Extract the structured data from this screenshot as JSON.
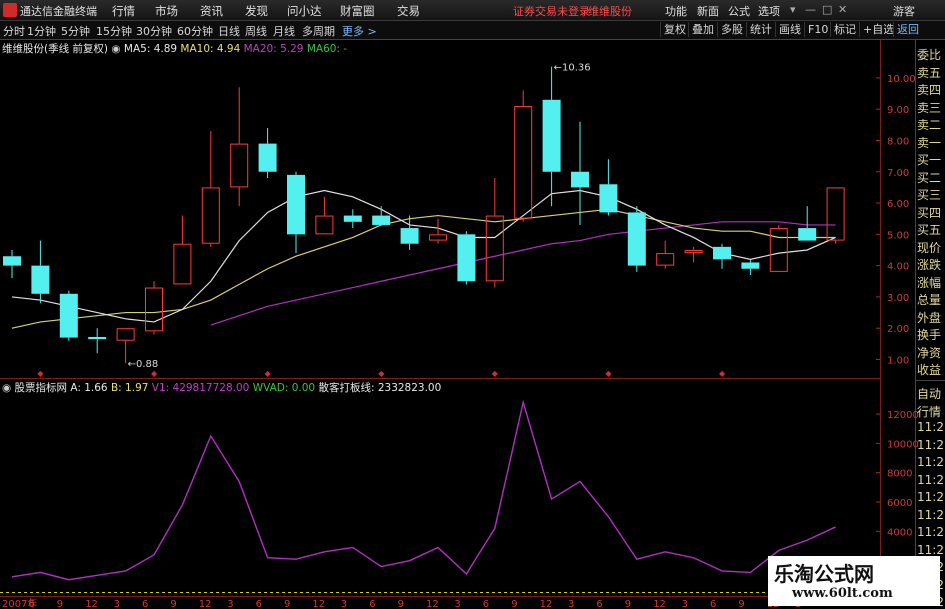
{
  "app": {
    "title": "通达信金融终端"
  },
  "menu": [
    "行情",
    "市场",
    "资讯",
    "发现",
    "问小达",
    "财富圈",
    "交易"
  ],
  "alerts": {
    "trade_login": "证券交易未登录",
    "stock": "维维股份"
  },
  "right_menu": [
    "功能",
    "新面",
    "公式",
    "选项"
  ],
  "guest_label": "游客",
  "toolbar": {
    "periods": [
      "分时",
      "1分钟",
      "5分钟",
      "15分钟",
      "30分钟",
      "60分钟",
      "日线",
      "周线",
      "月线",
      "多周期"
    ],
    "more": "更多",
    "right": [
      "复权",
      "叠加",
      "多股",
      "统计",
      "画线",
      "F10",
      "标记",
      "+自选",
      "返回"
    ]
  },
  "main_chart": {
    "stock_info": "维维股份(季线 前复权)",
    "ma": [
      {
        "label": "MA5: 4.89",
        "color": "#e8e8e8"
      },
      {
        "label": "MA10: 4.94",
        "color": "#e8e070"
      },
      {
        "label": "MA20: 5.29",
        "color": "#c040c0"
      },
      {
        "label": "MA60: -",
        "color": "#40c040"
      }
    ],
    "high_label": "10.36",
    "low_label": "0.88"
  },
  "sub_chart": {
    "indicator": "股票指标网",
    "values": [
      {
        "label": "A: 1.66",
        "color": "#e8e8e8"
      },
      {
        "label": "B: 1.97",
        "color": "#e8e070"
      },
      {
        "label": "V1: 429817728.00",
        "color": "#c040c0"
      },
      {
        "label": "WVAD: 0.00",
        "color": "#40c040"
      },
      {
        "label": "散客打板线: 2332823.00",
        "color": "#e8e8e8"
      }
    ]
  },
  "right_panel_top": [
    "委比",
    "卖五",
    "卖四",
    "卖三",
    "卖二",
    "卖一",
    "买一",
    "买二",
    "买三",
    "买四",
    "买五",
    "现价",
    "涨跌",
    "涨幅",
    "总量",
    "外盘",
    "换手",
    "净资",
    "收益"
  ],
  "right_panel_bottom": [
    "自动",
    "行情",
    "11:2",
    "11:2",
    "11:2",
    "11:2",
    "11:2",
    "11:2",
    "11:2",
    "11:2",
    "11:2",
    "11:2",
    "11:2"
  ],
  "chart_data": [
    {
      "type": "candlestick",
      "title": "维维股份(季线 前复权)",
      "ylim": [
        0.6,
        10.7
      ],
      "yticks": [
        "10.00",
        "9.00",
        "8.00",
        "7.00",
        "6.00",
        "5.00",
        "4.00",
        "3.00",
        "2.00",
        "1.00"
      ],
      "ytick_values": [
        10,
        9,
        8,
        7,
        6,
        5,
        4,
        3,
        2,
        1
      ],
      "candles": [
        {
          "o": 4.3,
          "h": 4.5,
          "l": 3.6,
          "c": 4.0
        },
        {
          "o": 4.0,
          "h": 4.8,
          "l": 2.8,
          "c": 3.1
        },
        {
          "o": 3.1,
          "h": 3.2,
          "l": 1.6,
          "c": 1.7
        },
        {
          "o": 1.72,
          "h": 2.0,
          "l": 1.2,
          "c": 1.65
        },
        {
          "o": 1.6,
          "h": 2.0,
          "l": 0.88,
          "c": 2.0
        },
        {
          "o": 1.9,
          "h": 3.5,
          "l": 1.8,
          "c": 3.3
        },
        {
          "o": 3.4,
          "h": 5.6,
          "l": 3.4,
          "c": 4.7
        },
        {
          "o": 4.7,
          "h": 8.3,
          "l": 4.6,
          "c": 6.5
        },
        {
          "o": 6.5,
          "h": 9.7,
          "l": 5.9,
          "c": 7.9
        },
        {
          "o": 7.9,
          "h": 8.4,
          "l": 6.8,
          "c": 7.0
        },
        {
          "o": 6.9,
          "h": 7.0,
          "l": 4.4,
          "c": 5.0
        },
        {
          "o": 5.0,
          "h": 6.2,
          "l": 5.0,
          "c": 5.6
        },
        {
          "o": 5.6,
          "h": 5.8,
          "l": 5.2,
          "c": 5.4
        },
        {
          "o": 5.6,
          "h": 5.9,
          "l": 5.3,
          "c": 5.3
        },
        {
          "o": 5.2,
          "h": 5.6,
          "l": 4.5,
          "c": 4.7
        },
        {
          "o": 4.8,
          "h": 5.5,
          "l": 4.7,
          "c": 5.0
        },
        {
          "o": 5.0,
          "h": 5.1,
          "l": 3.4,
          "c": 3.5
        },
        {
          "o": 3.5,
          "h": 6.8,
          "l": 3.3,
          "c": 5.6
        },
        {
          "o": 5.5,
          "h": 9.6,
          "l": 5.4,
          "c": 9.1
        },
        {
          "o": 9.3,
          "h": 10.36,
          "l": 5.9,
          "c": 7.0
        },
        {
          "o": 7.0,
          "h": 8.6,
          "l": 5.3,
          "c": 6.5
        },
        {
          "o": 6.6,
          "h": 7.4,
          "l": 5.6,
          "c": 5.7
        },
        {
          "o": 5.7,
          "h": 5.9,
          "l": 3.8,
          "c": 4.0
        },
        {
          "o": 4.0,
          "h": 4.8,
          "l": 3.9,
          "c": 4.4
        },
        {
          "o": 4.4,
          "h": 4.6,
          "l": 4.1,
          "c": 4.5
        },
        {
          "o": 4.6,
          "h": 4.7,
          "l": 3.9,
          "c": 4.2
        },
        {
          "o": 4.1,
          "h": 4.2,
          "l": 3.7,
          "c": 3.9
        },
        {
          "o": 3.8,
          "h": 5.3,
          "l": 3.8,
          "c": 5.2
        },
        {
          "o": 5.2,
          "h": 5.9,
          "l": 4.8,
          "c": 4.8
        },
        {
          "o": 4.8,
          "h": 6.5,
          "l": 4.7,
          "c": 6.5
        }
      ],
      "ma5": [
        3.0,
        2.9,
        2.7,
        2.5,
        2.3,
        2.2,
        2.6,
        3.5,
        4.8,
        5.7,
        6.2,
        6.4,
        6.2,
        5.8,
        5.3,
        5.2,
        4.9,
        4.9,
        5.6,
        6.3,
        6.4,
        6.2,
        5.8,
        5.3,
        4.9,
        4.4,
        4.2,
        4.4,
        4.5,
        4.9
      ],
      "ma10": [
        2.0,
        2.2,
        2.3,
        2.4,
        2.5,
        2.5,
        2.6,
        2.9,
        3.4,
        3.9,
        4.3,
        4.6,
        4.9,
        5.3,
        5.5,
        5.6,
        5.5,
        5.4,
        5.5,
        5.6,
        5.7,
        5.8,
        5.6,
        5.4,
        5.2,
        5.1,
        5.1,
        4.9,
        4.9,
        4.9
      ],
      "ma20": [
        null,
        null,
        null,
        null,
        null,
        null,
        null,
        2.1,
        2.4,
        2.7,
        2.9,
        3.1,
        3.3,
        3.5,
        3.7,
        3.9,
        4.1,
        4.3,
        4.5,
        4.7,
        4.8,
        5.0,
        5.1,
        5.2,
        5.3,
        5.4,
        5.4,
        5.4,
        5.3,
        5.3
      ]
    },
    {
      "type": "line",
      "title": "股票指标网",
      "ylim": [
        0,
        13500
      ],
      "yticks": [
        "12000",
        "10000",
        "8000",
        "6000",
        "4000",
        "2000"
      ],
      "ytick_values": [
        12000,
        10000,
        8000,
        6000,
        4000,
        2000
      ],
      "series": [
        {
          "name": "V1",
          "values": [
            900,
            1200,
            700,
            1000,
            1300,
            2400,
            5800,
            10500,
            7400,
            2200,
            2100,
            2600,
            2900,
            1600,
            2000,
            2900,
            1100,
            4200,
            12800,
            6200,
            7400,
            5000,
            2100,
            2600,
            2200,
            1300,
            1200,
            2700,
            3400,
            4300
          ]
        }
      ],
      "x_tick_labels": [
        "2007年",
        "6",
        "9",
        "12",
        "3",
        "6",
        "9",
        "12",
        "3",
        "6",
        "9",
        "12",
        "3",
        "6",
        "9",
        "12",
        "3",
        "6",
        "9",
        "12",
        "3",
        "6",
        "9",
        "12",
        "3",
        "6",
        "9",
        "12",
        "3"
      ]
    }
  ],
  "watermark": {
    "line1": "乐淘公式网",
    "line2": "www.60lt.com"
  }
}
